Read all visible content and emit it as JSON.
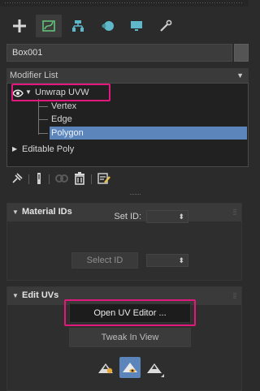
{
  "object": {
    "name": "Box001"
  },
  "command_panel": {
    "tabs": [
      {
        "icon": "create-plus-icon"
      },
      {
        "icon": "modify-curve-icon",
        "active": true
      },
      {
        "icon": "hierarchy-icon"
      },
      {
        "icon": "motion-icon"
      },
      {
        "icon": "display-monitor-icon"
      },
      {
        "icon": "utilities-wrench-icon"
      }
    ]
  },
  "modifier_list": {
    "label": "Modifier List"
  },
  "stack": {
    "unwrap": {
      "label": "Unwrap UVW",
      "visible": true,
      "expanded": true
    },
    "subobjects": [
      {
        "label": "Vertex",
        "selected": false
      },
      {
        "label": "Edge",
        "selected": false
      },
      {
        "label": "Polygon",
        "selected": true
      }
    ],
    "base": {
      "label": "Editable Poly",
      "expanded": false
    }
  },
  "stack_tools": [
    "pin-stack-icon",
    "show-end-result-icon",
    "make-unique-icon",
    "remove-modifier-icon",
    "configure-modifier-sets-icon"
  ],
  "material_ids": {
    "title": "Material IDs",
    "set_id_label": "Set ID:",
    "set_id_value": "",
    "select_id_label": "Select ID",
    "select_id_value": ""
  },
  "edit_uvs": {
    "title": "Edit UVs",
    "open_editor_label": "Open UV Editor ...",
    "tweak_label": "Tweak In View",
    "tools": [
      {
        "icon": "peel-mode-icon",
        "active": false
      },
      {
        "icon": "tweak-uv-eye-icon",
        "active": true
      },
      {
        "icon": "pelt-map-icon",
        "active": false
      }
    ]
  },
  "colors": {
    "panel_bg": "#2b2b2b",
    "selection": "#5b85bb",
    "highlight": "#e2187d"
  }
}
